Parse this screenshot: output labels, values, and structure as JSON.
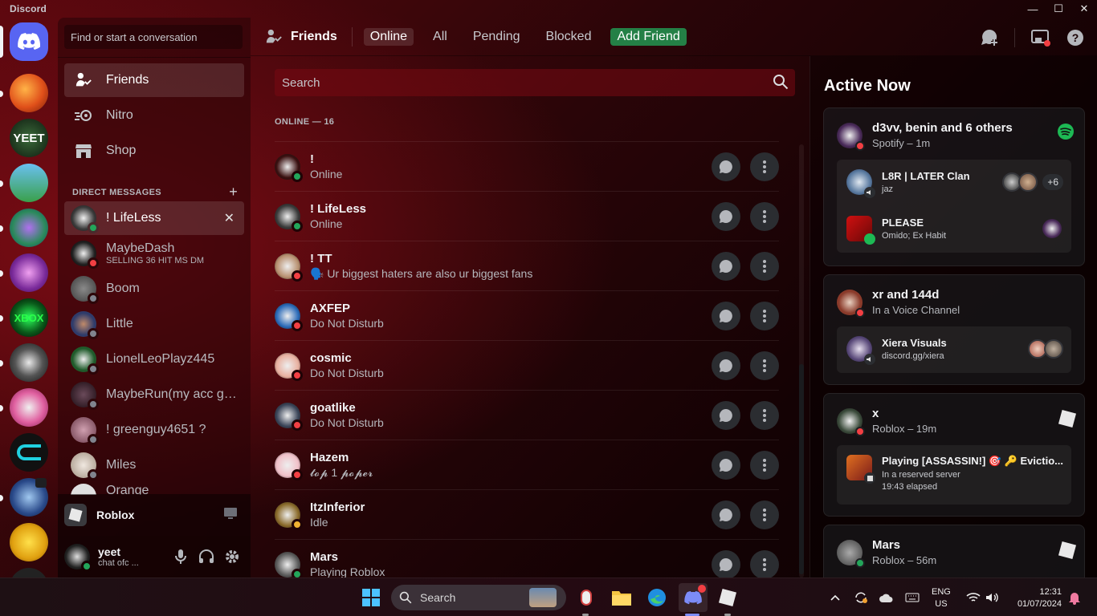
{
  "window": {
    "app_name": "Discord",
    "controls": [
      "—",
      "☐",
      "✕"
    ]
  },
  "sidebar": {
    "search_placeholder": "Find or start a conversation",
    "nav": [
      {
        "label": "Friends",
        "icon": "friends-icon"
      },
      {
        "label": "Nitro",
        "icon": "nitro-icon"
      },
      {
        "label": "Shop",
        "icon": "shop-icon"
      }
    ],
    "dm_header": "DIRECT MESSAGES",
    "dms": [
      {
        "name": "! LifeLess",
        "sub": "",
        "status": "online",
        "color": "#3a3a3a"
      },
      {
        "name": "MaybeDash",
        "sub": "SELLING 36 HIT MS DM",
        "status": "dnd",
        "color": "#222222"
      },
      {
        "name": "Boom",
        "sub": "",
        "status": "offline",
        "color": "#56585a"
      },
      {
        "name": "Little",
        "sub": "",
        "status": "offline",
        "color": "#2f3b6a"
      },
      {
        "name": "LionelLeoPlayz445",
        "sub": "",
        "status": "offline",
        "color": "#1f5a2a"
      },
      {
        "name": "MaybeRun(my acc got...",
        "sub": "",
        "status": "offline",
        "color": "#3b2a30"
      },
      {
        "name": "! greenguy4651 ?",
        "sub": "",
        "status": "offline",
        "color": "#9a6a7a"
      },
      {
        "name": "Miles",
        "sub": "",
        "status": "offline",
        "color": "#c9b9a9"
      },
      {
        "name": "Orange",
        "sub": "",
        "status": "offline",
        "color": "#e0e0e0"
      }
    ],
    "activity": {
      "name": "Roblox"
    },
    "user": {
      "name": "yeet",
      "status_text": "chat ofc ..."
    }
  },
  "header": {
    "title": "Friends",
    "tabs": [
      "Online",
      "All",
      "Pending",
      "Blocked"
    ],
    "add_friend": "Add Friend"
  },
  "friends": {
    "search_placeholder": "Search",
    "online_label": "ONLINE — 16",
    "list": [
      {
        "name": "!",
        "status_text": "Online",
        "status": "online",
        "color": "#3a1010"
      },
      {
        "name": "! LifeLess",
        "status_text": "Online",
        "status": "online",
        "color": "#3a3a3a"
      },
      {
        "name": "! TT",
        "status_text": "🗣️ Ur biggest haters are also ur biggest fans",
        "status": "dnd",
        "color": "#b89070"
      },
      {
        "name": "AXFEP",
        "status_text": "Do Not Disturb",
        "status": "dnd",
        "color": "#2a6ab8"
      },
      {
        "name": "cosmic",
        "status_text": "Do Not Disturb",
        "status": "dnd",
        "color": "#e8b0a0"
      },
      {
        "name": "goatlike",
        "status_text": "Do Not Disturb",
        "status": "dnd",
        "color": "#3a4458"
      },
      {
        "name": "Hazem",
        "status_text": "𝓽𝓸𝓹 1 𝓹𝓸𝓹𝓮𝓻",
        "status": "dnd",
        "color": "#f0c0c8"
      },
      {
        "name": "ItzInferior",
        "status_text": "Idle",
        "status": "idle",
        "color": "#8a6a2a"
      },
      {
        "name": "Mars",
        "status_text": "Playing Roblox",
        "status": "online",
        "color": "#5a5a5a"
      }
    ]
  },
  "active_now": {
    "title": "Active Now",
    "cards": [
      {
        "name": "d3vv, benin and 6 others",
        "sub": "Spotify – 1m",
        "rows": [
          {
            "name": "L8R | LATER Clan",
            "sub": "jaz",
            "extra": "+6"
          },
          {
            "name": "PLEASE",
            "sub": "Omido; Ex Habit"
          }
        ]
      },
      {
        "name": "xr and 144d",
        "sub": "In a Voice Channel",
        "rows": [
          {
            "name": "Xiera Visuals",
            "sub": "discord.gg/xiera"
          }
        ]
      },
      {
        "name": "x",
        "sub": "Roblox – 19m",
        "rows": [
          {
            "name": "Playing [ASSASSIN!] 🎯 🔑 Evictio...",
            "sub": "In a reserved server",
            "sub2": "19:43 elapsed"
          }
        ]
      },
      {
        "name": "Mars",
        "sub": "Roblox – 56m",
        "rows": []
      }
    ]
  },
  "taskbar": {
    "search_label": "Search",
    "lang_top": "ENG",
    "lang_bottom": "US",
    "time": "12:31",
    "date": "01/07/2024"
  },
  "colors": {
    "accent": "#5865f2",
    "online": "#23a55a",
    "dnd": "#f23f43",
    "idle": "#f0b232",
    "add_friend": "#248046",
    "spotify": "#1db954"
  }
}
